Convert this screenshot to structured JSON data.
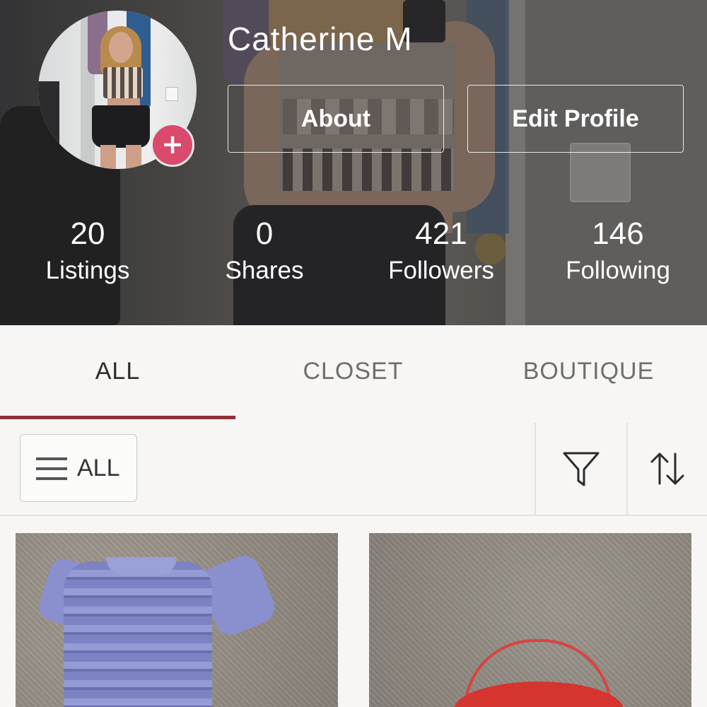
{
  "profile": {
    "name": "Catherine M",
    "about_label": "About",
    "edit_label": "Edit Profile",
    "add_symbol": "+"
  },
  "stats": [
    {
      "value": "20",
      "label": "Listings"
    },
    {
      "value": "0",
      "label": "Shares"
    },
    {
      "value": "421",
      "label": "Followers"
    },
    {
      "value": "146",
      "label": "Following"
    }
  ],
  "tabs": [
    {
      "label": "ALL",
      "active": true
    },
    {
      "label": "CLOSET",
      "active": false
    },
    {
      "label": "BOUTIQUE",
      "active": false
    }
  ],
  "filter": {
    "category_label": "ALL",
    "filter_icon": "funnel-icon",
    "sort_icon": "sort-arrows-icon",
    "menu_icon": "hamburger-icon"
  },
  "colors": {
    "accent": "#8f2f3a",
    "add_button": "#d94a6d",
    "background": "#f7f6f5"
  }
}
